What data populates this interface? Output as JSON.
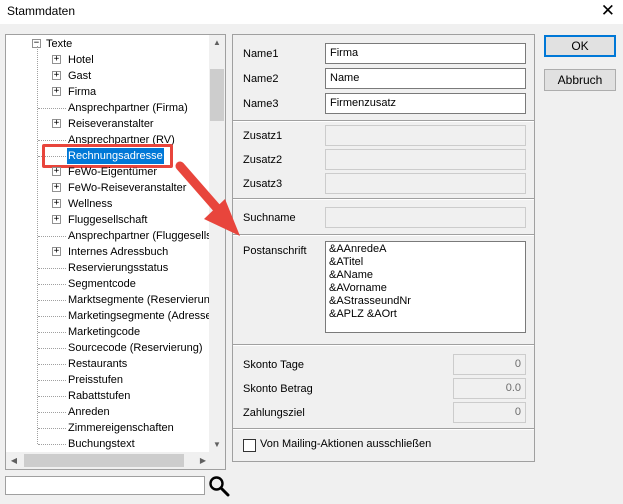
{
  "window": {
    "title": "Stammdaten",
    "close_glyph": "✕"
  },
  "tree": {
    "root": {
      "label": "Texte",
      "expander": "−"
    },
    "items": [
      {
        "label": "Hotel",
        "expander": "+"
      },
      {
        "label": "Gast",
        "expander": "+"
      },
      {
        "label": "Firma",
        "expander": "+"
      },
      {
        "label": "Ansprechpartner (Firma)",
        "expander": ""
      },
      {
        "label": "Reiseveranstalter",
        "expander": "+"
      },
      {
        "label": "Ansprechpartner (RV)",
        "expander": ""
      },
      {
        "label": "Rechnungsadresse",
        "expander": "",
        "selected": true
      },
      {
        "label": "FeWo-Eigentümer",
        "expander": "+"
      },
      {
        "label": "FeWo-Reiseveranstalter",
        "expander": "+"
      },
      {
        "label": "Wellness",
        "expander": "+"
      },
      {
        "label": "Fluggesellschaft",
        "expander": "+"
      },
      {
        "label": "Ansprechpartner (Fluggesellsc",
        "expander": ""
      },
      {
        "label": "Internes Adressbuch",
        "expander": "+"
      },
      {
        "label": "Reservierungsstatus",
        "expander": ""
      },
      {
        "label": "Segmentcode",
        "expander": ""
      },
      {
        "label": "Marktsegmente (Reservierung",
        "expander": ""
      },
      {
        "label": "Marketingsegmente (Adresse)",
        "expander": ""
      },
      {
        "label": "Marketingcode",
        "expander": ""
      },
      {
        "label": "Sourcecode (Reservierung)",
        "expander": ""
      },
      {
        "label": "Restaurants",
        "expander": ""
      },
      {
        "label": "Preisstufen",
        "expander": ""
      },
      {
        "label": "Rabattstufen",
        "expander": ""
      },
      {
        "label": "Anreden",
        "expander": ""
      },
      {
        "label": "Zimmereigenschaften",
        "expander": ""
      },
      {
        "label": "Buchungstext",
        "expander": ""
      }
    ]
  },
  "search": {
    "value": ""
  },
  "form": {
    "name1": {
      "label": "Name1",
      "value": "Firma"
    },
    "name2": {
      "label": "Name2",
      "value": "Name"
    },
    "name3": {
      "label": "Name3",
      "value": "Firmenzusatz"
    },
    "zusatz1": {
      "label": "Zusatz1",
      "value": ""
    },
    "zusatz2": {
      "label": "Zusatz2",
      "value": ""
    },
    "zusatz3": {
      "label": "Zusatz3",
      "value": ""
    },
    "suchname": {
      "label": "Suchname",
      "value": ""
    },
    "postanschrift": {
      "label": "Postanschrift",
      "lines": [
        "&AAnredeA",
        "&ATitel",
        "&AName",
        "&AVorname",
        "&AStrasseundNr",
        "&APLZ &AOrt"
      ]
    },
    "skonto_tage": {
      "label": "Skonto Tage",
      "value": "0"
    },
    "skonto_betrag": {
      "label": "Skonto Betrag",
      "value": "0.0"
    },
    "zahlungsziel": {
      "label": "Zahlungsziel",
      "value": "0"
    },
    "mailing_checkbox": {
      "label": "Von Mailing-Aktionen ausschließen",
      "checked": false
    }
  },
  "buttons": {
    "ok": "OK",
    "abbruch": "Abbruch"
  },
  "colors": {
    "annotation": "#e8453c",
    "selection": "#0078d7"
  }
}
